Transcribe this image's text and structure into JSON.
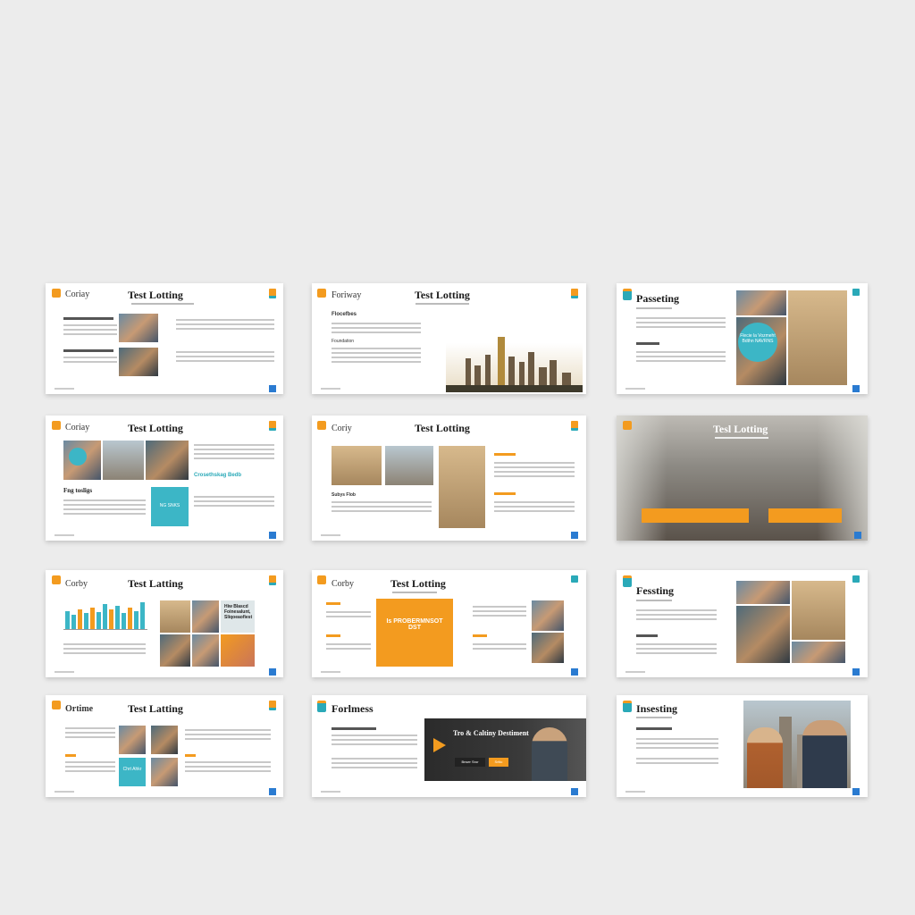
{
  "colors": {
    "accent_orange": "#f39b1f",
    "accent_teal": "#3cb6c6",
    "accent_blue": "#2a7bd1",
    "background": "#ececec"
  },
  "slides": [
    {
      "logo": "Coriay",
      "title": "Test Lotting"
    },
    {
      "logo": "Foriway",
      "title": "Test Lotting",
      "section": "Flocefbes",
      "section2": "Foundation"
    },
    {
      "title": "Passeting",
      "circle_text": "Flecie la Vozmeht Bdthn NAVRNS"
    },
    {
      "logo": "Coriay",
      "title": "Test Lotting",
      "section": "Fng tosligs",
      "side_head": "Crosethskag Bedb",
      "teal_text": "NG SNKS"
    },
    {
      "logo": "Coriy",
      "title": "Test Lotting",
      "section": "Subys Flob"
    },
    {
      "title": "Tesl Lotting"
    },
    {
      "logo": "Corby",
      "title": "Test Latting",
      "card_text": "Hiw Blascd Foinesalunt, Sliqoeaofiest"
    },
    {
      "logo": "Corby",
      "title": "Test Lotting",
      "orange_text": "Is PROBERMNSOT DST"
    },
    {
      "title": "Fessting"
    },
    {
      "logo": "Ortime",
      "title": "Test Latting",
      "teal_text": "Chrt Ahkr"
    },
    {
      "title": "Forlmess",
      "banner_title": "Tro & Caltiny Destiment",
      "banner_btn1": "Bnser Sror",
      "banner_btn2": "Sritic"
    },
    {
      "title": "Insesting"
    }
  ]
}
